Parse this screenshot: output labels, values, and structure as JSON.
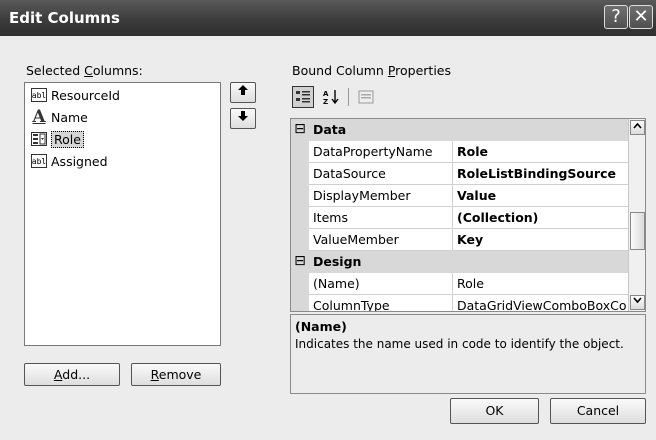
{
  "window": {
    "title": "Edit Columns",
    "help_glyph": "?",
    "close_glyph": "✕"
  },
  "left": {
    "label_pre": "Selected ",
    "label_key": "C",
    "label_post": "olumns:",
    "items": [
      {
        "icon": "textbox-column-icon",
        "icon_text": "abl",
        "label": "ResourceId"
      },
      {
        "icon": "label-column-icon",
        "icon_text": "A",
        "label": "Name"
      },
      {
        "icon": "combobox-column-icon",
        "icon_text": "",
        "label": "Role",
        "selected": true
      },
      {
        "icon": "textbox-column-icon",
        "icon_text": "abl",
        "label": "Assigned"
      }
    ],
    "move_up_glyph": "🡅",
    "move_down_glyph": "🡇",
    "add_key": "A",
    "add_rest": "dd...",
    "remove_key": "R",
    "remove_rest": "emove"
  },
  "right": {
    "label_pre": "Bound Column ",
    "label_key": "P",
    "label_post": "roperties",
    "toolbar": {
      "categorized_icon": "categorized-icon",
      "alphabetical_icon": "alphabetical-sort-icon",
      "property_pages_icon": "property-pages-icon"
    },
    "rows": [
      {
        "type": "category",
        "toggle": "⊟",
        "name": "Data"
      },
      {
        "type": "prop",
        "name": "DataPropertyName",
        "value": "Role",
        "bold": true
      },
      {
        "type": "prop",
        "name": "DataSource",
        "value": "RoleListBindingSource",
        "bold": true
      },
      {
        "type": "prop",
        "name": "DisplayMember",
        "value": "Value",
        "bold": true
      },
      {
        "type": "prop",
        "name": "Items",
        "value": "(Collection)",
        "bold": true
      },
      {
        "type": "prop",
        "name": "ValueMember",
        "value": "Key",
        "bold": true
      },
      {
        "type": "category",
        "toggle": "⊟",
        "name": "Design"
      },
      {
        "type": "prop",
        "name": "(Name)",
        "value": "Role",
        "bold": false
      },
      {
        "type": "prop",
        "name": "ColumnType",
        "value": "DataGridViewComboBoxCo",
        "bold": false
      }
    ],
    "description": {
      "title": "(Name)",
      "text": "Indicates the name used in code to identify the object."
    }
  },
  "buttons": {
    "ok": "OK",
    "cancel": "Cancel"
  }
}
